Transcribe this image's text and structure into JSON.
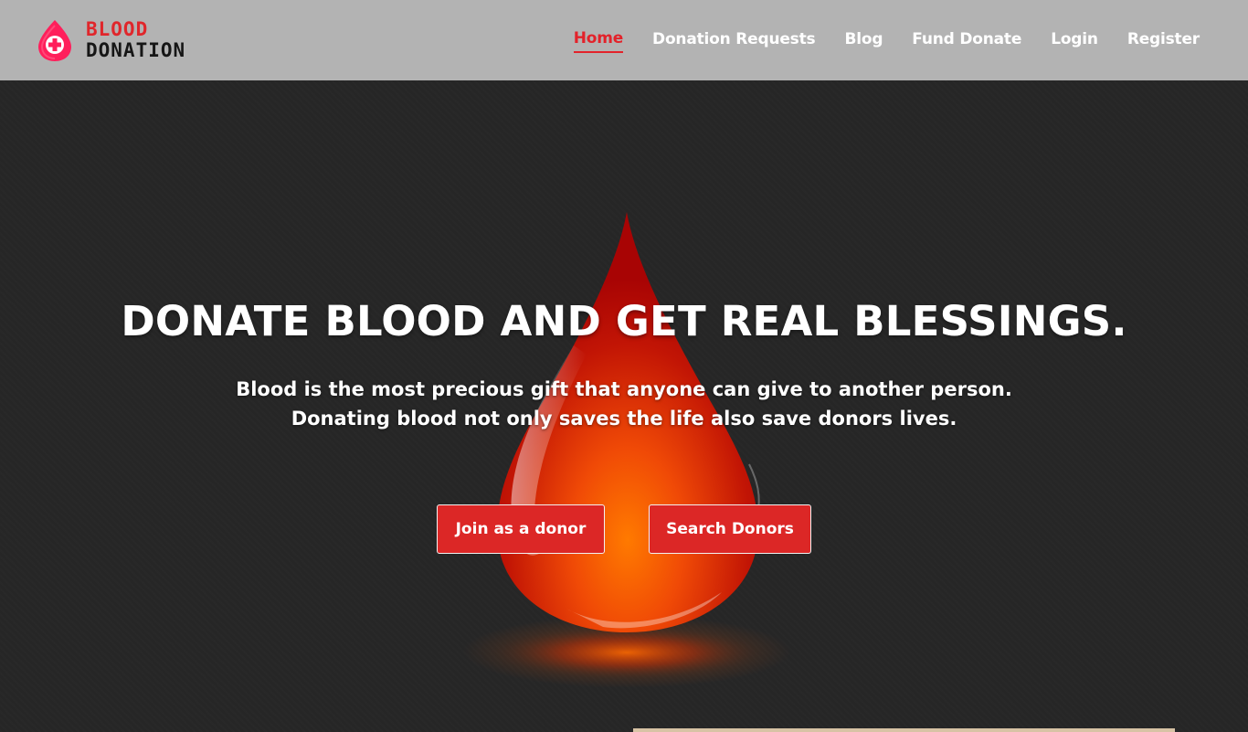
{
  "brand": {
    "line1": "BLOOD",
    "line2": "DONATION",
    "icon": "blood-drop-plus-icon",
    "colors": {
      "red": "#e0262b",
      "dark": "#161616"
    }
  },
  "nav": {
    "items": [
      {
        "label": "Home",
        "active": true
      },
      {
        "label": "Donation Requests",
        "active": false
      },
      {
        "label": "Blog",
        "active": false
      },
      {
        "label": "Fund Donate",
        "active": false
      },
      {
        "label": "Login",
        "active": false
      },
      {
        "label": "Register",
        "active": false
      }
    ],
    "active_color": "#e3222a",
    "background": "#b3b3b3"
  },
  "hero": {
    "title": "DONATE BLOOD AND GET REAL BLESSINGS.",
    "subtitle_line1": "Blood is the most precious gift that anyone can give to another person.",
    "subtitle_line2": "Donating blood not only saves the life also save donors lives.",
    "background": "#262626",
    "illustration": "blood-drop-image",
    "buttons": {
      "join_label": "Join as a donor",
      "search_label": "Search Donors",
      "color": "#dc2726"
    }
  }
}
